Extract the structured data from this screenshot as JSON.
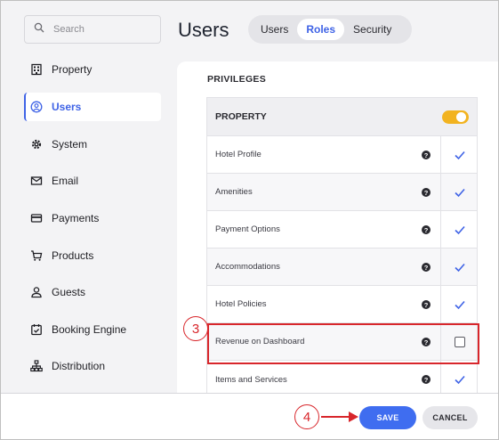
{
  "sidebar": {
    "search": {
      "placeholder": "Search",
      "icon": "search-icon"
    },
    "items": [
      {
        "label": "Property",
        "icon": "building-icon",
        "active": false
      },
      {
        "label": "Users",
        "icon": "user-circle-icon",
        "active": true
      },
      {
        "label": "System",
        "icon": "gear-icon",
        "active": false
      },
      {
        "label": "Email",
        "icon": "envelope-icon",
        "active": false
      },
      {
        "label": "Payments",
        "icon": "credit-card-icon",
        "active": false
      },
      {
        "label": "Products",
        "icon": "cart-icon",
        "active": false
      },
      {
        "label": "Guests",
        "icon": "person-icon",
        "active": false
      },
      {
        "label": "Booking Engine",
        "icon": "calendar-check-icon",
        "active": false
      },
      {
        "label": "Distribution",
        "icon": "sitemap-icon",
        "active": false
      }
    ]
  },
  "header": {
    "title": "Users",
    "tabs": [
      {
        "label": "Users",
        "active": false
      },
      {
        "label": "Roles",
        "active": true
      },
      {
        "label": "Security",
        "active": false
      }
    ]
  },
  "main": {
    "section_label": "PRIVILEGES",
    "group": {
      "label": "PROPERTY",
      "toggle_on": true
    },
    "rows": [
      {
        "label": "Hotel Profile",
        "help": "?",
        "checked": true
      },
      {
        "label": "Amenities",
        "help": "?",
        "checked": true
      },
      {
        "label": "Payment Options",
        "help": "?",
        "checked": true
      },
      {
        "label": "Accommodations",
        "help": "?",
        "checked": true
      },
      {
        "label": "Hotel Policies",
        "help": "?",
        "checked": true
      },
      {
        "label": "Revenue on Dashboard",
        "help": "?",
        "checked": false
      },
      {
        "label": "Items and Services",
        "help": "?",
        "checked": true
      }
    ]
  },
  "footer": {
    "save_label": "SAVE",
    "cancel_label": "CANCEL"
  },
  "annotations": {
    "step3": "3",
    "step4": "4"
  },
  "colors": {
    "accent": "#3f63e6",
    "toggle": "#f2b320",
    "annotation": "#d8262b",
    "save": "#3f6df0"
  }
}
